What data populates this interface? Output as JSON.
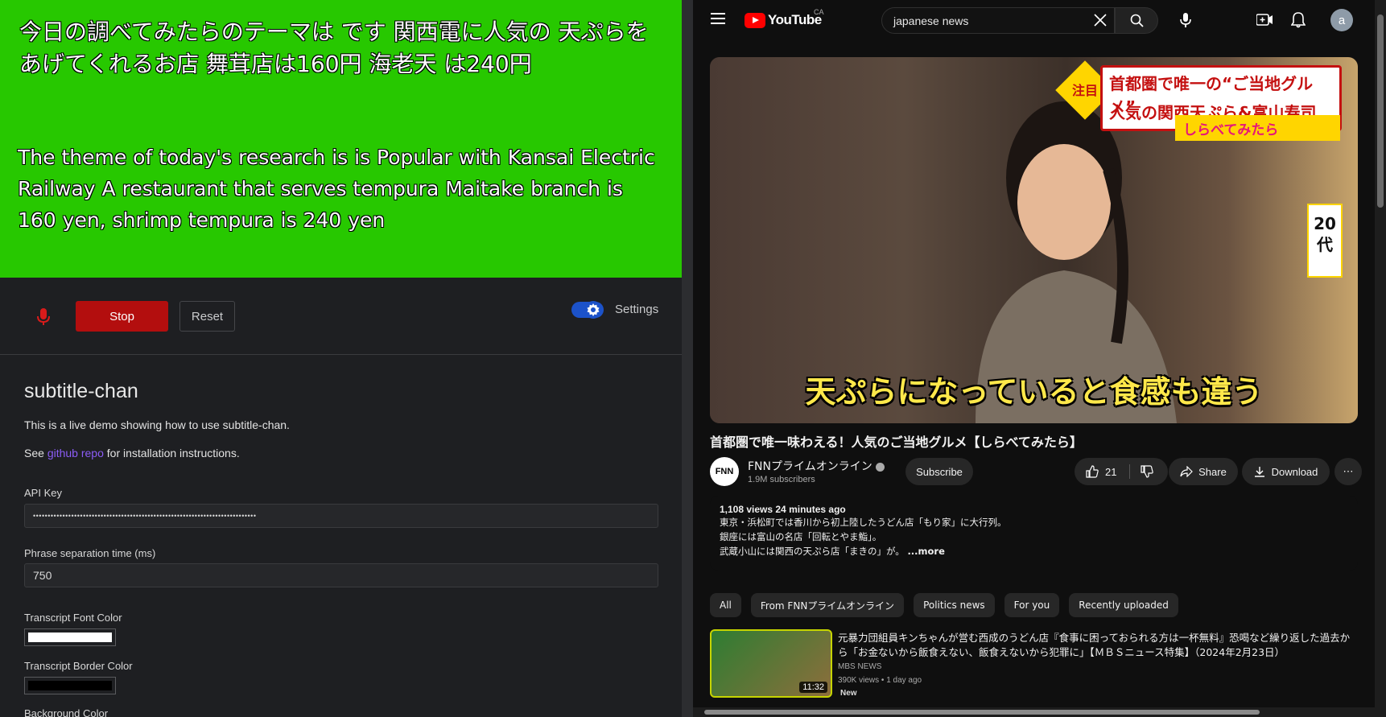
{
  "caption": {
    "ja": "今日の調べてみたらのテーマは です 関西電に人気の 天ぷらをあげてくれるお店 舞茸店は160円 海老天 は240円",
    "en": "The theme of today's research is is Popular with Kansai Electric Railway A restaurant that serves tempura Maitake branch is 160 yen, shrimp tempura is 240 yen"
  },
  "controls": {
    "stop_label": "Stop",
    "reset_label": "Reset",
    "settings_label": "Settings",
    "accent": "#1c52c9",
    "stop_color": "#b30e0e"
  },
  "app": {
    "title": "subtitle-chan",
    "description": "This is a live demo showing how to use subtitle-chan.",
    "see_prefix": "See ",
    "repo_link": "github repo",
    "see_suffix": " for installation instructions.",
    "api_key_label": "API Key",
    "api_key_value": "••••••••••••••••••••••••••••••••••••••••••••••••••••••••••••••••••••••••••••",
    "phrase_label": "Phrase separation time (ms)",
    "phrase_value": "750",
    "font_color_label": "Transcript Font Color",
    "font_color": "#ffffff",
    "border_color_label": "Transcript Border Color",
    "border_color": "#000000",
    "bg_color_label": "Background Color"
  },
  "youtube": {
    "brand": "YouTube",
    "country": "CA",
    "search_value": "japanese news",
    "avatar_letter": "a",
    "video": {
      "overlay_tag_1": "首都圏で唯一の“ご当地グルメ”",
      "overlay_tag_2": "人気の関西天ぷら&富山寿司",
      "overlay_note": "注目",
      "overlay_show": "しらべてみたら",
      "overlay_age": "20代",
      "overlay_subtitle": "天ぷらになっていると食感も違う"
    },
    "title": "首都圏で唯一味わえる！人気のご当地グルメ【しらべてみたら】",
    "channel_logo": "FNN",
    "channel_name": "FNNプライムオンライン",
    "subscribers": "1.9M subscribers",
    "subscribe_label": "Subscribe",
    "likes": "21",
    "share_label": "Share",
    "download_label": "Download",
    "more_label": "⋯",
    "description": {
      "meta": "1,108 views  24 minutes ago",
      "line1": "東京・浜松町では香川から初上陸したうどん店「もり家」に大行列。",
      "line2": "銀座には富山の名店「回転とやま鮨」。",
      "line3": "武蔵小山には関西の天ぷら店「まきの」が。",
      "more": "...more"
    },
    "chips": [
      "All",
      "From FNNプライムオンライン",
      "Politics news",
      "For you",
      "Recently uploaded"
    ],
    "recommendation": {
      "title": "元暴力団組員キンちゃんが営む西成のうどん店『食事に困っておられる方は一杯無料』恐喝など繰り返した過去から「お金ないから飯食えない、飯食えないから犯罪に」【ＭＢＳニュース特集】（2024年2月23日）",
      "duration": "11:32",
      "channel": "MBS NEWS",
      "meta": "390K views  • 1 day ago",
      "badge": "New"
    }
  }
}
